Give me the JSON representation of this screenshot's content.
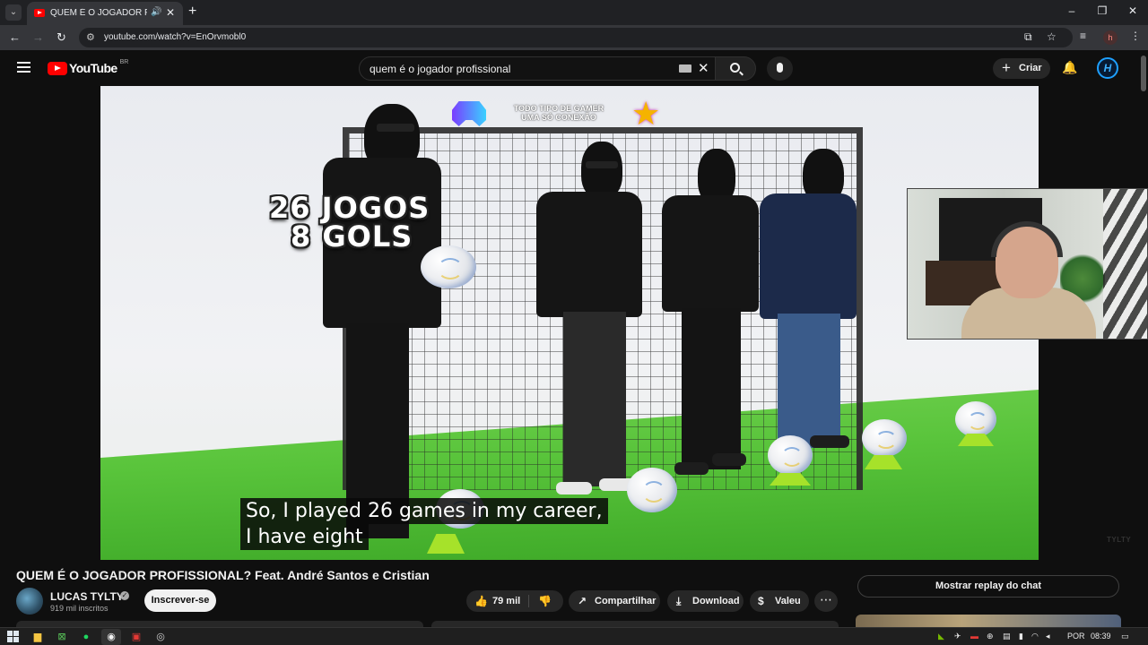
{
  "browser": {
    "tab_title": "QUEM É O JOGADOR PROF",
    "new_tab": "+",
    "url": "youtube.com/watch?v=EnOrvmobl0",
    "profile_initial": "h",
    "window_controls": [
      "–",
      "❐",
      "✕"
    ]
  },
  "youtube": {
    "logo_text": "YouTube",
    "region": "BR",
    "search_query": "quem é o jogador profissional",
    "create_label": "Criar",
    "avatar_initial": "H"
  },
  "video": {
    "overlay_line1": "26 JOGOS",
    "overlay_line2": "8 GOLS",
    "banner_line1": "TODO TIPO DE GAMER",
    "banner_line2": "UMA SÓ CONEXÃO",
    "caption_line1": "So, I played 26 games in my career,",
    "caption_line2": "I have eight",
    "watermark": "TYLTY",
    "title": "QUEM É O JOGADOR PROFISSIONAL? Feat. André Santos e Cristian"
  },
  "channel": {
    "name": "LUCAS TYLTY",
    "subscribers": "919 mil inscritos",
    "subscribe_label": "Inscrever-se"
  },
  "actions": {
    "likes": "79 mil",
    "share": "Compartilhar",
    "download": "Download",
    "thanks": "Valeu",
    "more": "⋯"
  },
  "sidebar": {
    "chat_replay": "Mostrar replay do chat"
  },
  "taskbar": {
    "language": "POR",
    "time": "08:39"
  },
  "icons": {
    "like": "thumbs-up-icon",
    "dislike": "thumbs-down-icon",
    "share": "share-icon",
    "download": "download-icon",
    "thanks": "thanks-icon"
  },
  "colors": {
    "youtube_red": "#ff0000",
    "page_bg": "#0f0f0f",
    "pill_bg": "#272727",
    "caption_bg": "#080808"
  }
}
